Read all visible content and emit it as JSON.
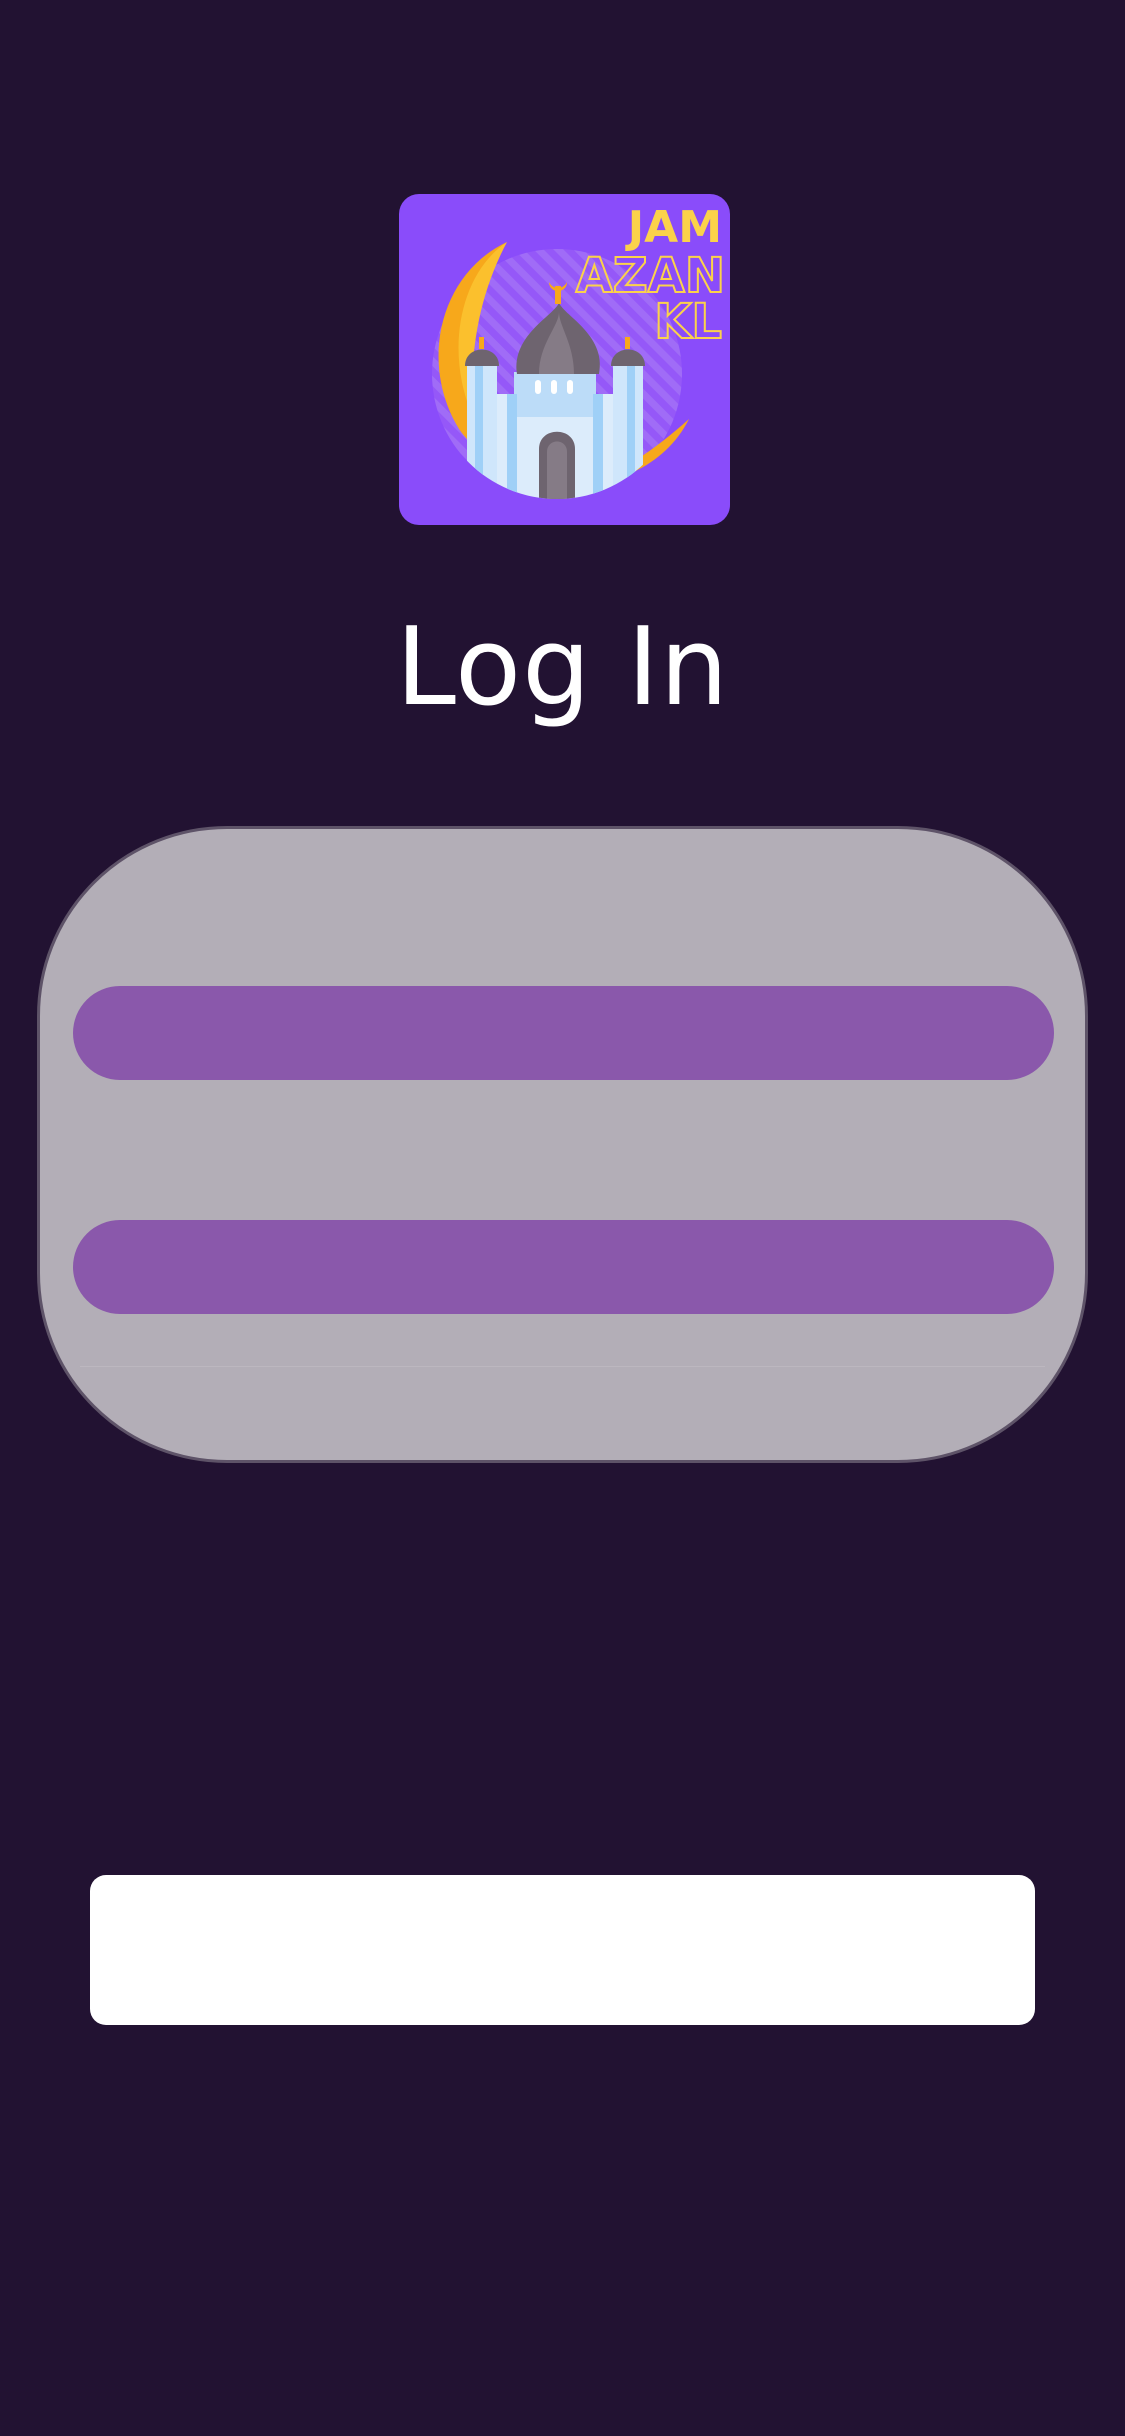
{
  "app": {
    "logo_lines": [
      "JAM",
      "AZAN",
      "KL"
    ]
  },
  "page": {
    "title": "Log In"
  },
  "form": {
    "field_1_value": "",
    "field_2_value": ""
  },
  "actions": {
    "submit_label": ""
  },
  "colors": {
    "background": "#221232",
    "logo_bg": "#8a4cfa",
    "card": "#b3aeb7",
    "field": "#8a58ab",
    "button": "#ffffff"
  }
}
